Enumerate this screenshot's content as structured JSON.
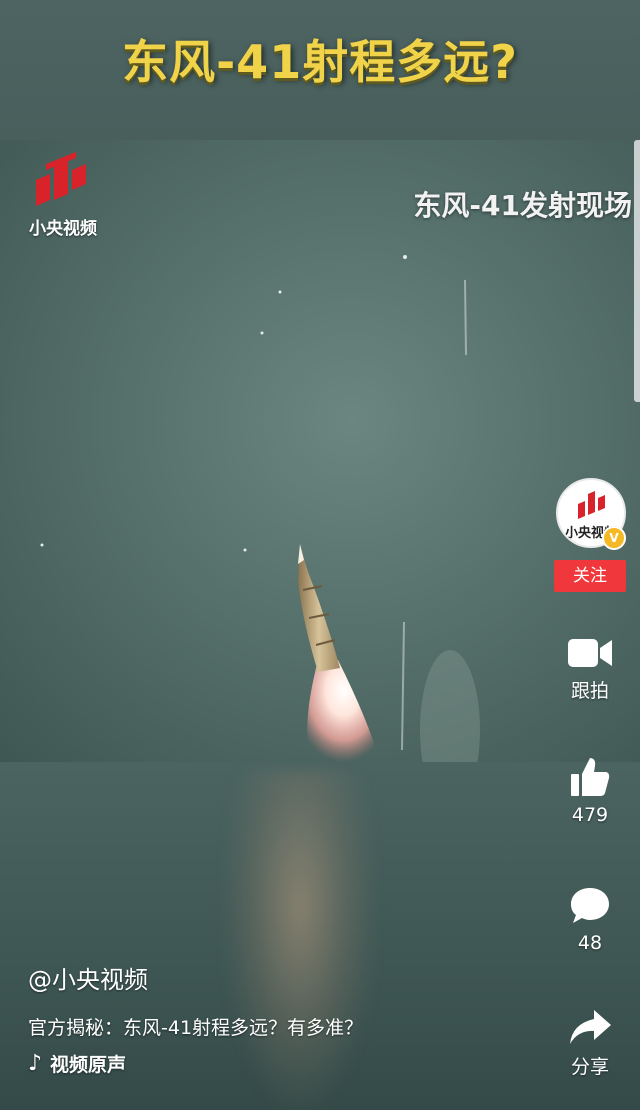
{
  "headline": "东风-41射程多远?",
  "video": {
    "logo_text": "小央视频",
    "caption": "东风-41发射现场"
  },
  "sidebar": {
    "avatar_text": "小央视频",
    "verified_badge": "V",
    "follow_label": "关注",
    "actions": [
      {
        "icon": "camera-icon",
        "label": "跟拍"
      },
      {
        "icon": "thumbs-up-icon",
        "label": "479"
      },
      {
        "icon": "comment-icon",
        "label": "48"
      },
      {
        "icon": "share-icon",
        "label": "分享"
      }
    ]
  },
  "bottom": {
    "author": "@小央视频",
    "description": "官方揭秘：东风-41射程多远？有多准？",
    "music_icon": "music-note-icon",
    "music": "视频原声"
  },
  "colors": {
    "headline": "#f1d34a",
    "follow_button": "#f0383c",
    "logo_red": "#d8232a",
    "badge": "#f5b925"
  }
}
